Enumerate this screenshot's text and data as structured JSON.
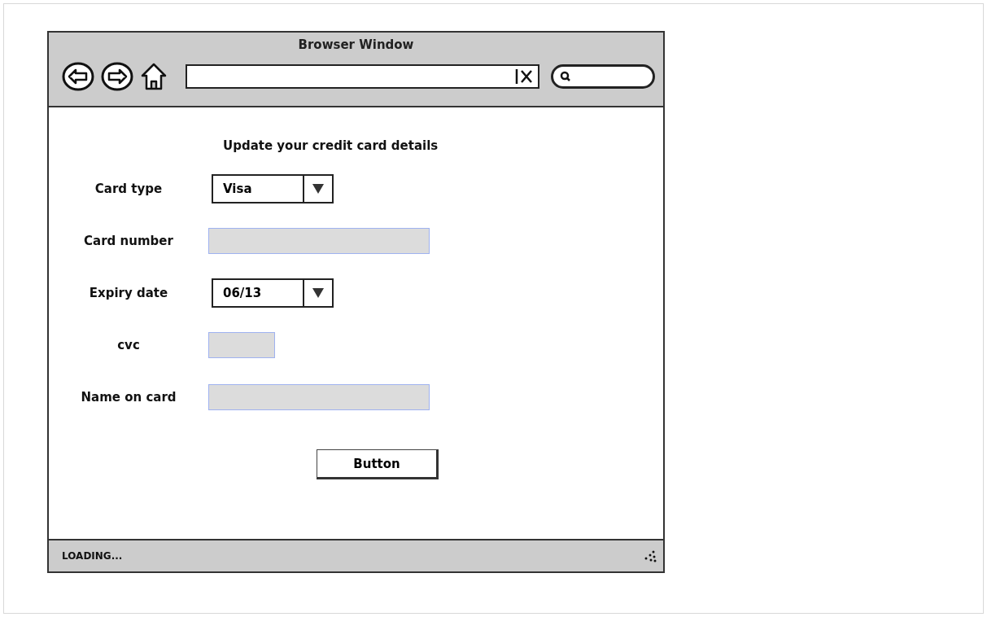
{
  "window": {
    "title": "Browser Window"
  },
  "form": {
    "title": "Update your credit card details",
    "fields": [
      {
        "label": "Card type",
        "kind": "select",
        "value": "Visa"
      },
      {
        "label": "Card number",
        "kind": "text"
      },
      {
        "label": "Expiry date",
        "kind": "select",
        "value": "06/13"
      },
      {
        "label": "cvc",
        "kind": "short-text"
      },
      {
        "label": "Name on card",
        "kind": "text"
      }
    ],
    "button": "Button"
  },
  "status_bar": {
    "text": "LOADING..."
  }
}
